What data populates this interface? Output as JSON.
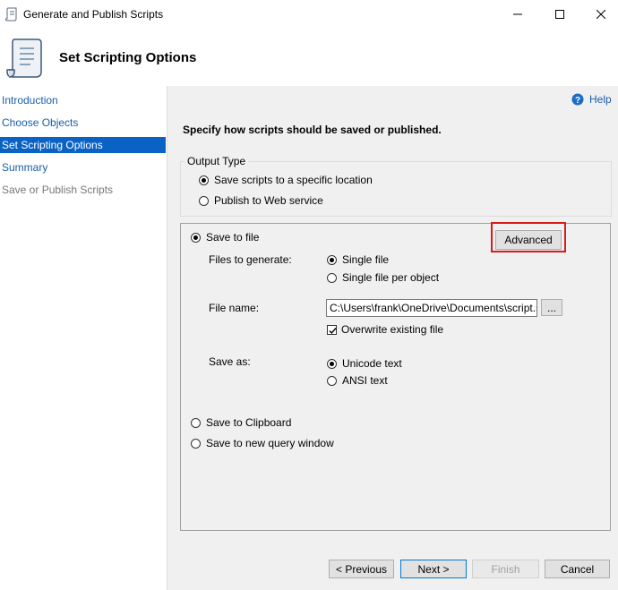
{
  "window": {
    "title": "Generate and Publish Scripts"
  },
  "header": {
    "title": "Set Scripting Options"
  },
  "sidebar": {
    "items": [
      {
        "label": "Introduction"
      },
      {
        "label": "Choose Objects"
      },
      {
        "label": "Set Scripting Options"
      },
      {
        "label": "Summary"
      },
      {
        "label": "Save or Publish Scripts"
      }
    ]
  },
  "help": {
    "label": "Help"
  },
  "main": {
    "instruction": "Specify how scripts should be saved or published.",
    "output_type": {
      "legend": "Output Type",
      "option_specific": "Save scripts to a specific location",
      "option_web": "Publish to Web service"
    },
    "save_to_file": "Save to file",
    "advanced": "Advanced",
    "files_to_generate": {
      "label": "Files to generate:",
      "single": "Single file",
      "per_object": "Single file per object"
    },
    "file_name": {
      "label": "File name:",
      "value": "C:\\Users\\frank\\OneDrive\\Documents\\script.sql",
      "browse": "..."
    },
    "overwrite": "Overwrite existing file",
    "save_as": {
      "label": "Save as:",
      "unicode": "Unicode text",
      "ansi": "ANSI text"
    },
    "clipboard": "Save to Clipboard",
    "query_window": "Save to new query window"
  },
  "footer": {
    "previous": "< Previous",
    "next": "Next >",
    "finish": "Finish",
    "cancel": "Cancel"
  }
}
